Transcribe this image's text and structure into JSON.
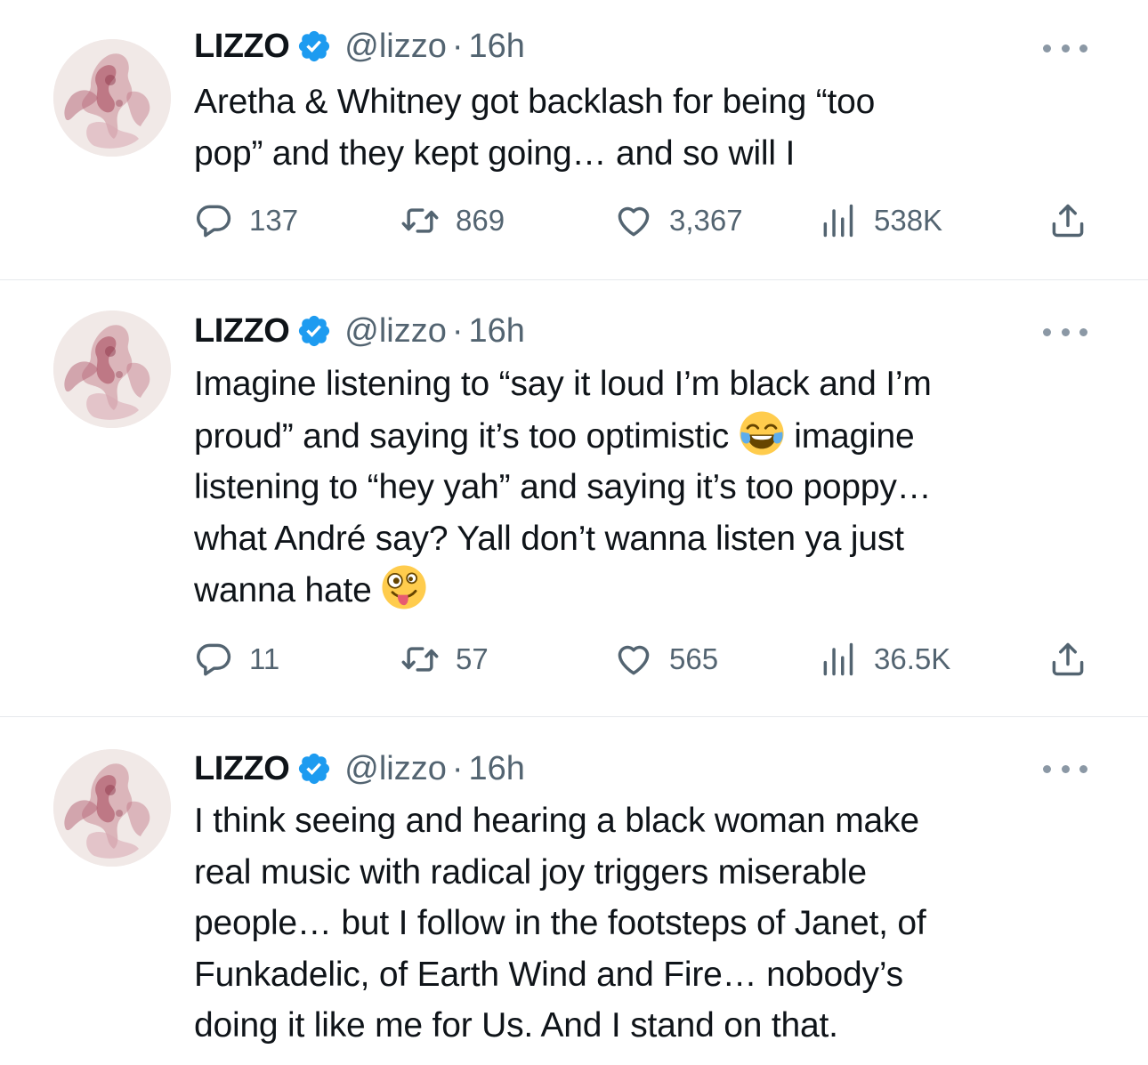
{
  "colors": {
    "text": "#0f1419",
    "secondary": "#536471",
    "verified": "#1d9bf0",
    "divider": "#e6e9ec"
  },
  "icons": {
    "verified": "verified-badge-icon",
    "more": "more-horizontal-icon",
    "reply": "reply-icon",
    "retweet": "retweet-icon",
    "like": "heart-icon",
    "views": "views-chart-icon",
    "share": "share-upload-icon"
  },
  "tweets": [
    {
      "author": {
        "name": "LIZZO",
        "handle": "@lizzo",
        "separator": "·",
        "time": "16h"
      },
      "lines": [
        "Aretha & Whitney got backlash for being “too",
        "pop” and they kept going… and so will I"
      ],
      "stats": {
        "replies": "137",
        "retweets": "869",
        "likes": "3,367",
        "views": "538K"
      }
    },
    {
      "author": {
        "name": "LIZZO",
        "handle": "@lizzo",
        "separator": "·",
        "time": "16h"
      },
      "lines": [
        "Imagine listening to “say it loud I’m black and I’m",
        "proud” and saying it’s too optimistic",
        " imagine",
        "listening to “hey yah” and saying it’s too poppy…",
        "what André say? Yall don’t wanna listen ya just",
        "wanna hate "
      ],
      "emojis": [
        "face-with-tears-of-joy-emoji",
        "zany-face-emoji"
      ],
      "stats": {
        "replies": "11",
        "retweets": "57",
        "likes": "565",
        "views": "36.5K"
      }
    },
    {
      "author": {
        "name": "LIZZO",
        "handle": "@lizzo",
        "separator": "·",
        "time": "16h"
      },
      "lines": [
        "I think seeing and hearing a black woman make",
        "real music with radical joy triggers miserable",
        "people… but I follow in the footsteps of Janet, of",
        "Funkadelic, of Earth Wind and Fire… nobody’s",
        "doing it like me for Us. And I stand on that."
      ]
    }
  ]
}
